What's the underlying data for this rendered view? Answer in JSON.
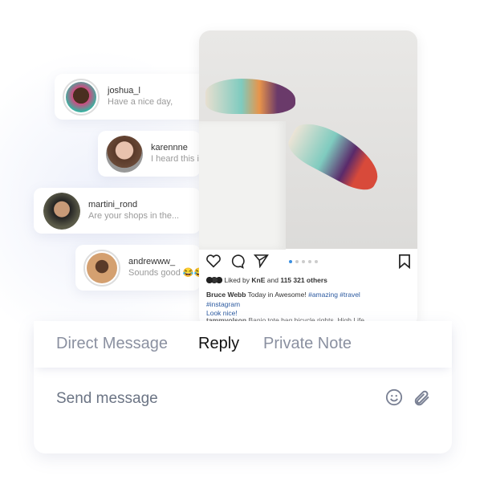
{
  "conversations": [
    {
      "username": "joshua_l",
      "preview": "Have a nice day,",
      "avatar_color": "#5a3a2a"
    },
    {
      "username": "karennne",
      "preview": "I heard this is a good",
      "avatar_color": "#c9a18a"
    },
    {
      "username": "martini_rond",
      "preview": "Are your shops in the...",
      "avatar_color": "#3a3a30"
    },
    {
      "username": "andrewww_",
      "preview": "Sounds good 😂😂",
      "avatar_color": "#c89a70"
    }
  ],
  "post": {
    "liked_by_prefix": "Liked by ",
    "liked_by_user": "KnE",
    "liked_by_mid": " and ",
    "likes_count": "115 321 others",
    "author": "Bruce Webb",
    "caption": " Today in Awesome! ",
    "tags": "#amazing #travel",
    "tag2": "#instagram",
    "comment_1": "Look nice!",
    "comment_user": "tammyolson",
    "comment_2": " Banjo tote bag bicycle rights, High Life",
    "carousel_pages": 5,
    "carousel_active": 1,
    "accent": "#3b8fe0"
  },
  "composer": {
    "tabs": [
      {
        "label": "Direct Message"
      },
      {
        "label": "Reply",
        "active": true
      },
      {
        "label": "Private Note"
      }
    ],
    "placeholder": "Send message",
    "icons": [
      "emoji-icon",
      "paperclip-icon"
    ]
  }
}
